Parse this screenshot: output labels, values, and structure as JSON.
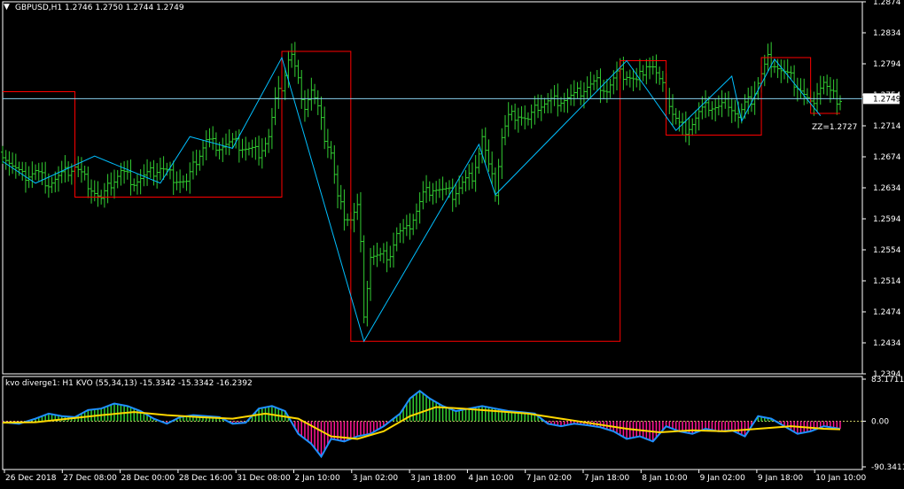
{
  "colors": {
    "background": "#000000",
    "frame": "#ffffff",
    "bars": "#32cd32",
    "zigzag": "#00bfff",
    "channel": "#ff0000",
    "bid_line": "#87ceeb",
    "kvo_line": "#1e90ff",
    "signal_line": "#ffd700",
    "hist_up": "#32cd32",
    "hist_down": "#ff1493",
    "zero_line": "#c8c864"
  },
  "main_chart": {
    "header": "GBPUSD,H1  1.2746 1.2750 1.2744 1.2749",
    "dropdown_icon": "triangle-down-icon",
    "price_axis": [
      "1.2874",
      "1.2834",
      "1.2794",
      "1.2754",
      "1.2714",
      "1.2674",
      "1.2634",
      "1.2594",
      "1.2554",
      "1.2514",
      "1.2474",
      "1.2434",
      "1.2394"
    ],
    "bid_label": "1.2749",
    "zz_label": "ZZ=1.2727"
  },
  "indicator": {
    "header": "kvo diverge1: H1  KVO (55,34,13) -15.3342 -15.3342 -16.2392",
    "axis": [
      "83.1711",
      "0.00",
      "-90.3411"
    ]
  },
  "time_axis": [
    "26 Dec 2018",
    "27 Dec 08:00",
    "28 Dec 00:00",
    "28 Dec 16:00",
    "31 Dec 08:00",
    "2 Jan 10:00",
    "3 Jan 02:00",
    "3 Jan 18:00",
    "4 Jan 10:00",
    "7 Jan 02:00",
    "7 Jan 18:00",
    "8 Jan 10:00",
    "9 Jan 02:00",
    "9 Jan 18:00",
    "10 Jan 10:00"
  ],
  "chart_data": {
    "type": "line",
    "symbol": "GBPUSD",
    "timeframe": "H1",
    "ohlc_last": {
      "open": 1.2746,
      "high": 1.275,
      "low": 1.2744,
      "close": 1.2749
    },
    "ylim": [
      1.2394,
      1.2874
    ],
    "price_path": [
      [
        0,
        1.268
      ],
      [
        3,
        1.2662
      ],
      [
        6,
        1.2648
      ],
      [
        10,
        1.2655
      ],
      [
        14,
        1.264
      ],
      [
        18,
        1.265
      ],
      [
        22,
        1.2662
      ],
      [
        26,
        1.264
      ],
      [
        30,
        1.2618
      ],
      [
        33,
        1.264
      ],
      [
        36,
        1.2655
      ],
      [
        40,
        1.2642
      ],
      [
        44,
        1.265
      ],
      [
        48,
        1.266
      ],
      [
        52,
        1.2648
      ],
      [
        56,
        1.264
      ],
      [
        59,
        1.267
      ],
      [
        62,
        1.2695
      ],
      [
        66,
        1.2688
      ],
      [
        70,
        1.2692
      ],
      [
        74,
        1.2685
      ],
      [
        78,
        1.268
      ],
      [
        81,
        1.27
      ],
      [
        83,
        1.2745
      ],
      [
        85,
        1.2765
      ],
      [
        87,
        1.28
      ],
      [
        88,
        1.2805
      ],
      [
        90,
        1.277
      ],
      [
        92,
        1.274
      ],
      [
        94,
        1.276
      ],
      [
        96,
        1.2735
      ],
      [
        98,
        1.27
      ],
      [
        100,
        1.268
      ],
      [
        102,
        1.262
      ],
      [
        104,
        1.26
      ],
      [
        106,
        1.2595
      ],
      [
        108,
        1.261
      ],
      [
        109,
        1.256
      ],
      [
        110,
        1.246
      ],
      [
        111,
        1.251
      ],
      [
        112,
        1.2548
      ],
      [
        115,
        1.2545
      ],
      [
        118,
        1.255
      ],
      [
        120,
        1.2575
      ],
      [
        123,
        1.2578
      ],
      [
        126,
        1.2605
      ],
      [
        128,
        1.2625
      ],
      [
        131,
        1.2635
      ],
      [
        134,
        1.263
      ],
      [
        137,
        1.2625
      ],
      [
        140,
        1.264
      ],
      [
        143,
        1.265
      ],
      [
        145,
        1.268
      ],
      [
        146,
        1.27
      ],
      [
        148,
        1.266
      ],
      [
        150,
        1.263
      ],
      [
        152,
        1.27
      ],
      [
        154,
        1.2725
      ],
      [
        157,
        1.273
      ],
      [
        160,
        1.272
      ],
      [
        163,
        1.274
      ],
      [
        166,
        1.2745
      ],
      [
        170,
        1.2748
      ],
      [
        174,
        1.2752
      ],
      [
        178,
        1.2765
      ],
      [
        181,
        1.277
      ],
      [
        184,
        1.276
      ],
      [
        187,
        1.278
      ],
      [
        190,
        1.278
      ],
      [
        193,
        1.277
      ],
      [
        196,
        1.2795
      ],
      [
        198,
        1.279
      ],
      [
        200,
        1.277
      ],
      [
        202,
        1.2755
      ],
      [
        204,
        1.273
      ],
      [
        206,
        1.2715
      ],
      [
        208,
        1.271
      ],
      [
        210,
        1.2718
      ],
      [
        212,
        1.273
      ],
      [
        215,
        1.274
      ],
      [
        218,
        1.2738
      ],
      [
        221,
        1.2745
      ],
      [
        224,
        1.2725
      ],
      [
        226,
        1.274
      ],
      [
        228,
        1.2748
      ],
      [
        230,
        1.277
      ],
      [
        232,
        1.279
      ],
      [
        233,
        1.28
      ],
      [
        235,
        1.2795
      ],
      [
        237,
        1.2785
      ],
      [
        240,
        1.2775
      ],
      [
        243,
        1.276
      ],
      [
        246,
        1.274
      ],
      [
        248,
        1.276
      ],
      [
        250,
        1.277
      ],
      [
        252,
        1.2755
      ],
      [
        254,
        1.2748
      ],
      [
        255,
        1.2749
      ]
    ],
    "zigzag": [
      [
        0,
        1.2668
      ],
      [
        10,
        1.264
      ],
      [
        28,
        1.2675
      ],
      [
        48,
        1.264
      ],
      [
        57,
        1.27
      ],
      [
        70,
        1.2685
      ],
      [
        85,
        1.2802
      ],
      [
        110,
        1.2436
      ],
      [
        145,
        1.269
      ],
      [
        150,
        1.2625
      ],
      [
        190,
        1.2798
      ],
      [
        205,
        1.2708
      ],
      [
        222,
        1.2778
      ],
      [
        225,
        1.272
      ],
      [
        235,
        1.28
      ],
      [
        249,
        1.2727
      ]
    ],
    "channel": [
      [
        0,
        1.2758
      ],
      [
        22,
        1.2758
      ],
      [
        22,
        1.2622
      ],
      [
        85,
        1.2622
      ],
      [
        85,
        1.281
      ],
      [
        106,
        1.281
      ],
      [
        106,
        1.2436
      ],
      [
        188,
        1.2436
      ],
      [
        188,
        1.2798
      ],
      [
        202,
        1.2798
      ],
      [
        202,
        1.2702
      ],
      [
        231,
        1.2702
      ],
      [
        231,
        1.2802
      ],
      [
        246,
        1.2802
      ],
      [
        246,
        1.273
      ],
      [
        255,
        1.273
      ]
    ],
    "bid_price": 1.2749,
    "zz_value": 1.2727,
    "indicator": {
      "name": "KVO",
      "params": "(55,34,13)",
      "values": [
        -15.3342,
        -15.3342,
        -16.2392
      ],
      "ylim": [
        -90.3411,
        83.1711
      ],
      "kvo": [
        [
          0,
          -2
        ],
        [
          5,
          -5
        ],
        [
          10,
          5
        ],
        [
          14,
          15
        ],
        [
          18,
          10
        ],
        [
          22,
          8
        ],
        [
          26,
          22
        ],
        [
          30,
          25
        ],
        [
          34,
          35
        ],
        [
          38,
          30
        ],
        [
          42,
          20
        ],
        [
          46,
          5
        ],
        [
          50,
          -5
        ],
        [
          54,
          8
        ],
        [
          58,
          12
        ],
        [
          62,
          10
        ],
        [
          66,
          8
        ],
        [
          70,
          -5
        ],
        [
          74,
          -3
        ],
        [
          78,
          25
        ],
        [
          82,
          30
        ],
        [
          86,
          20
        ],
        [
          90,
          -25
        ],
        [
          94,
          -45
        ],
        [
          97,
          -70
        ],
        [
          100,
          -35
        ],
        [
          104,
          -40
        ],
        [
          108,
          -30
        ],
        [
          112,
          -25
        ],
        [
          116,
          -10
        ],
        [
          119,
          5
        ],
        [
          121,
          15
        ],
        [
          124,
          45
        ],
        [
          127,
          60
        ],
        [
          130,
          45
        ],
        [
          134,
          30
        ],
        [
          138,
          20
        ],
        [
          142,
          25
        ],
        [
          146,
          30
        ],
        [
          150,
          25
        ],
        [
          154,
          20
        ],
        [
          158,
          18
        ],
        [
          162,
          15
        ],
        [
          166,
          -5
        ],
        [
          170,
          -10
        ],
        [
          174,
          -5
        ],
        [
          178,
          -8
        ],
        [
          182,
          -12
        ],
        [
          186,
          -20
        ],
        [
          190,
          -35
        ],
        [
          194,
          -30
        ],
        [
          198,
          -40
        ],
        [
          202,
          -10
        ],
        [
          206,
          -20
        ],
        [
          210,
          -25
        ],
        [
          214,
          -15
        ],
        [
          218,
          -20
        ],
        [
          222,
          -18
        ],
        [
          226,
          -30
        ],
        [
          230,
          10
        ],
        [
          234,
          5
        ],
        [
          238,
          -10
        ],
        [
          242,
          -25
        ],
        [
          246,
          -20
        ],
        [
          250,
          -10
        ],
        [
          255,
          -15
        ]
      ],
      "signal": [
        [
          0,
          -3
        ],
        [
          10,
          -2
        ],
        [
          20,
          5
        ],
        [
          30,
          12
        ],
        [
          40,
          18
        ],
        [
          50,
          12
        ],
        [
          60,
          8
        ],
        [
          70,
          5
        ],
        [
          80,
          15
        ],
        [
          90,
          5
        ],
        [
          100,
          -30
        ],
        [
          108,
          -35
        ],
        [
          116,
          -20
        ],
        [
          124,
          10
        ],
        [
          132,
          28
        ],
        [
          140,
          25
        ],
        [
          150,
          20
        ],
        [
          160,
          15
        ],
        [
          170,
          5
        ],
        [
          180,
          -5
        ],
        [
          190,
          -15
        ],
        [
          200,
          -22
        ],
        [
          210,
          -18
        ],
        [
          220,
          -20
        ],
        [
          230,
          -15
        ],
        [
          240,
          -10
        ],
        [
          250,
          -15
        ],
        [
          255,
          -16
        ]
      ]
    }
  }
}
